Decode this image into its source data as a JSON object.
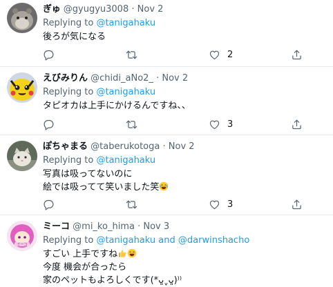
{
  "replies": [
    {
      "name": "ぎゅ",
      "handle": "@gyugyu3008",
      "date": "Nov 2",
      "replying_prefix": "Replying to",
      "mention": "@tanigahaku",
      "lines": [
        "後ろが気になる"
      ],
      "likes": "2",
      "avatar": "gray-hamster-avatar"
    },
    {
      "name": "えびみりん",
      "handle": "@chidi_aNo2_",
      "date": "Nov 2",
      "replying_prefix": "Replying to",
      "mention": "@tanigahaku",
      "lines": [
        "タピオカは上手にかけるんですね、、"
      ],
      "likes": "3",
      "avatar": "yellow-character-avatar"
    },
    {
      "name": "ぽちゃまる",
      "handle": "@taberukotoga",
      "date": "Nov 2",
      "replying_prefix": "Replying to",
      "mention": "@tanigahaku",
      "lines": [
        "写真は吸ってないのに",
        "絵では吸ってて笑いました笑"
      ],
      "likes": "3",
      "avatar": "cat-photo-avatar"
    },
    {
      "name": "ミーコ",
      "handle": "@mi_ko_hima",
      "date": "Nov 3",
      "replying_prefix": "Replying to",
      "mention": "@tanigahaku",
      "mention_joiner": "and",
      "mention2": "@darwinshacho",
      "lines": [
        "すごい 上手ですね",
        "今度 機会が合ったら",
        "家のペットもよろしくです(*ᴗ͈ˬᴗ͈)⁾⁾"
      ],
      "avatar": "pink-character-avatar"
    }
  ],
  "dot": "·",
  "colors": {
    "accent": "#1d9bf0",
    "text": "#0f1419",
    "muted": "#536471",
    "border": "#e6ecf0"
  },
  "icons": {
    "reply": "reply-icon",
    "retweet": "retweet-icon",
    "like": "heart-icon",
    "share": "share-icon"
  }
}
